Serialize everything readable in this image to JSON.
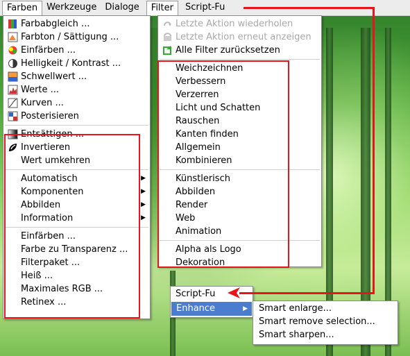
{
  "menubar": {
    "items": [
      "Farben",
      "Werkzeuge",
      "Dialoge",
      "Filter",
      "Script-Fu"
    ]
  },
  "farben_menu": {
    "group1": [
      "Farbabgleich ...",
      "Farbton / Sättigung ...",
      "Einfärben ...",
      "Helligkeit / Kontrast ...",
      "Schwellwert ...",
      "Werte ...",
      "Kurven ...",
      "Posterisieren"
    ],
    "group2": [
      "Entsättigen ...",
      "Invertieren",
      "Wert umkehren"
    ],
    "group3": [
      "Automatisch",
      "Komponenten",
      "Abbilden",
      "Information"
    ],
    "group4": [
      "Einfärben ...",
      "Farbe zu Transparenz ...",
      "Filterpaket ...",
      "Heiß ...",
      "Maximales RGB ...",
      "Retinex ..."
    ]
  },
  "filter_menu": {
    "top": [
      "Letzte Aktion wiederholen",
      "Letzte Aktion erneut anzeigen",
      "Alle Filter zurücksetzen"
    ],
    "group1": [
      "Weichzeichnen",
      "Verbessern",
      "Verzerren",
      "Licht und Schatten",
      "Rauschen",
      "Kanten finden",
      "Allgemein",
      "Kombinieren"
    ],
    "group2": [
      "Künstlerisch",
      "Abbilden",
      "Render",
      "Web",
      "Animation"
    ],
    "group3": [
      "Alpha als Logo",
      "Dekoration"
    ]
  },
  "scriptfu_menu": {
    "title": "Script-Fu",
    "enhance": "Enhance",
    "sub": [
      "Smart enlarge...",
      "Smart remove selection...",
      "Smart sharpen..."
    ]
  },
  "colors": {
    "highlight": "#e8141c",
    "selection": "#4a7ccf"
  }
}
